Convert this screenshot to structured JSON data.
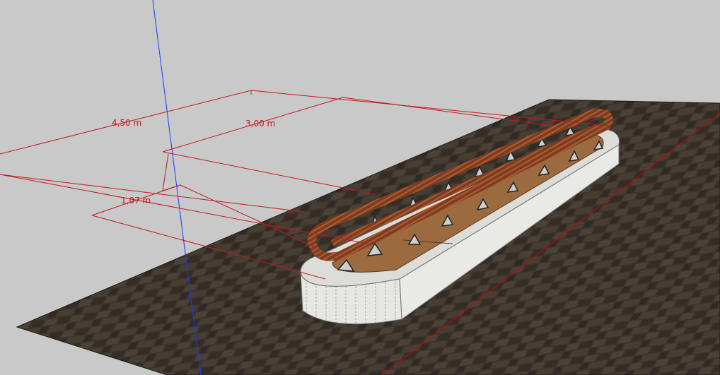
{
  "viewport": {
    "background_color": "#c9c9c9",
    "axis_colors": {
      "blue_axis": "#1a3cff",
      "red_axis": "#d30000"
    }
  },
  "dimensions": {
    "length_outer": "4,50 m",
    "length_inner": "3,00 m",
    "width": "1,07 m",
    "color": "#c11a1a"
  },
  "model": {
    "ground_color": "#3b342c",
    "planter_color": "#e6e6e3",
    "bench_wood_color": "#8b4a2a",
    "deck_color": "#9b6a3f"
  }
}
